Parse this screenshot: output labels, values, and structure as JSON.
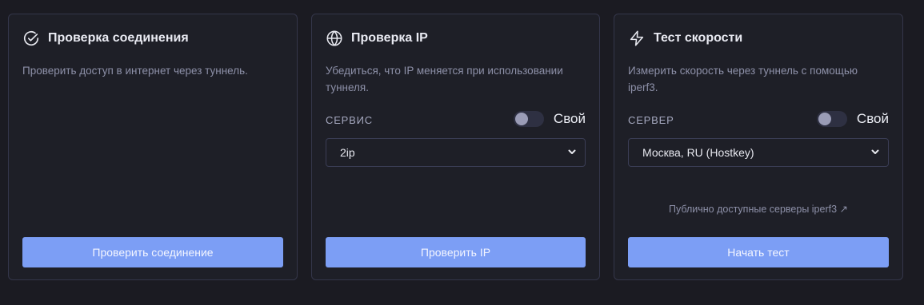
{
  "cards": [
    {
      "title": "Проверка соединения",
      "icon": "check-circle-icon",
      "description": "Проверить доступ в интернет через туннель.",
      "button_label": "Проверить соединение"
    },
    {
      "title": "Проверка IP",
      "icon": "globe-icon",
      "description": "Убедиться, что IP меняется при использовании туннеля.",
      "field_label": "СЕРВИС",
      "toggle_label": "Свой",
      "toggle_on": false,
      "select_value": "2ip",
      "button_label": "Проверить IP"
    },
    {
      "title": "Тест скорости",
      "icon": "lightning-icon",
      "description": "Измерить скорость через туннель с помощью iperf3.",
      "field_label": "СЕРВЕР",
      "toggle_label": "Свой",
      "toggle_on": false,
      "select_value": "Москва, RU (Hostkey)",
      "link_text": "Публично доступные серверы iperf3 ↗",
      "button_label": "Начать тест"
    }
  ],
  "colors": {
    "background": "#1b1b22",
    "card": "#1e1f27",
    "accent_button": "#7c9ef5",
    "muted_text": "#8d90a8"
  }
}
